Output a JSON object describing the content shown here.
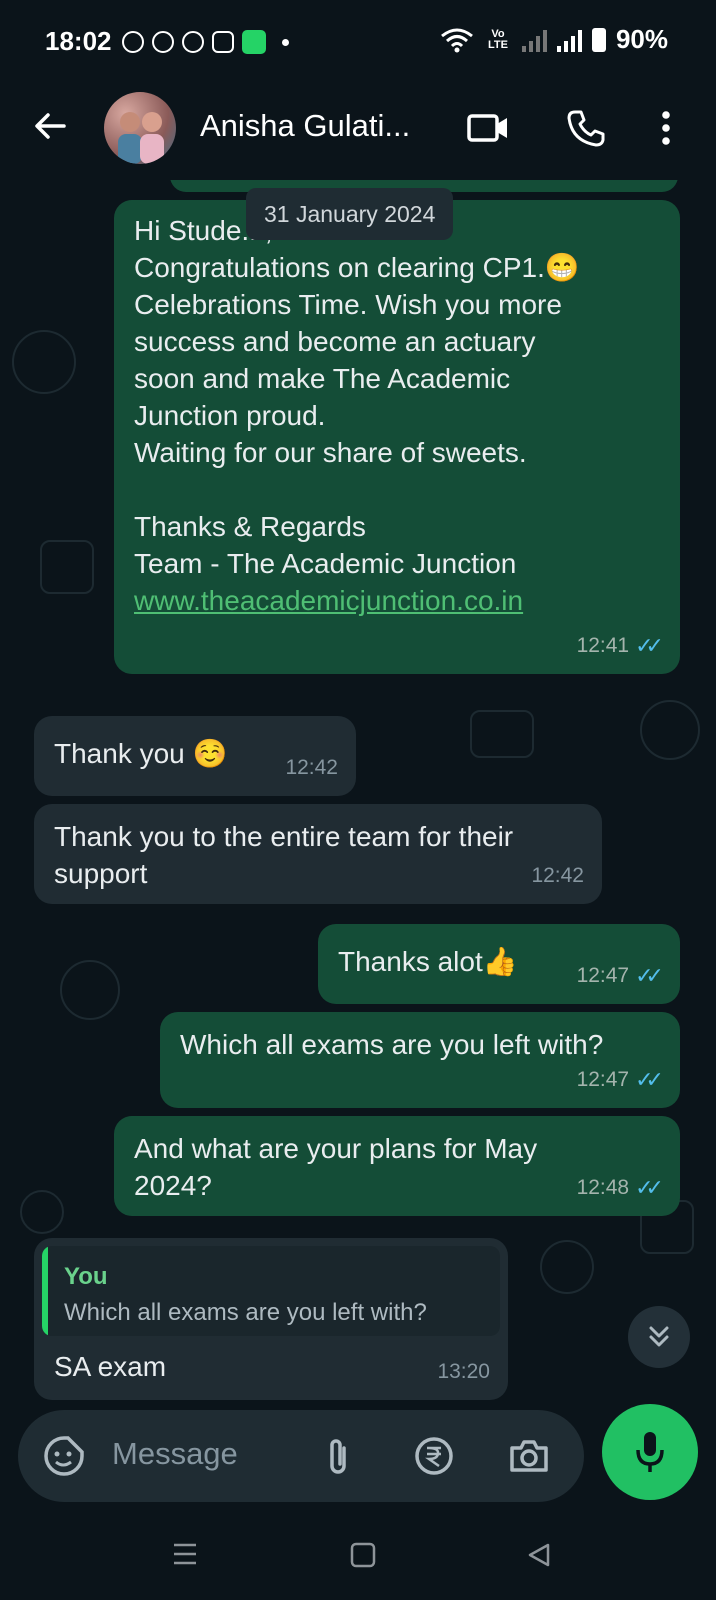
{
  "status_bar": {
    "time": "18:02",
    "network_label": "Vo LTE",
    "battery": "90%"
  },
  "header": {
    "contact_name": "Anisha Gulati..."
  },
  "date_chip": "31 January 2024",
  "messages": [
    {
      "direction": "out",
      "lines": [
        "Hi Stude...,",
        "Congratulations on clearing CP1.😁",
        "Celebrations Time. Wish you more",
        "success and become an actuary",
        "soon and make The Academic",
        "Junction proud.",
        "Waiting for our share of sweets.",
        "",
        "Thanks & Regards",
        "Team - The Academic Junction"
      ],
      "link": "www.theacademicjunction.co.in",
      "time": "12:41",
      "status": "read"
    },
    {
      "direction": "in",
      "text": "Thank you ☺️",
      "time": "12:42"
    },
    {
      "direction": "in",
      "lines": [
        "Thank you to the entire team for their",
        "support"
      ],
      "time": "12:42"
    },
    {
      "direction": "out",
      "text": "Thanks alot👍",
      "time": "12:47",
      "status": "read"
    },
    {
      "direction": "out",
      "text": "Which all exams are you left with?",
      "time": "12:47",
      "status": "read"
    },
    {
      "direction": "out",
      "lines": [
        "And what are your plans for May",
        "2024?"
      ],
      "time": "12:48",
      "status": "read"
    },
    {
      "direction": "in",
      "quote": {
        "author": "You",
        "text": "Which all exams are you left with?"
      },
      "text": "SA exam",
      "time": "13:20"
    }
  ],
  "input": {
    "placeholder": "Message"
  },
  "colors": {
    "background": "#0b141a",
    "outgoing_bubble": "#144d37",
    "incoming_bubble": "#202c33",
    "accent_green": "#21c063",
    "read_ticks": "#53bdeb"
  }
}
